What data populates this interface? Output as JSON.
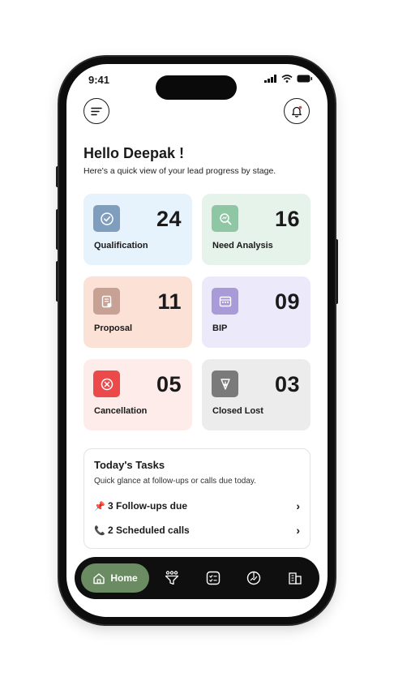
{
  "status_bar": {
    "time": "9:41"
  },
  "header": {
    "menu_icon": "menu-icon",
    "notification_icon": "bell-icon"
  },
  "greeting": {
    "title": "Hello Deepak !",
    "subtitle": "Here's a quick view of your lead progress by stage."
  },
  "stages": [
    {
      "label": "Qualification",
      "count": "24",
      "icon": "check-circle-icon",
      "card_color": "#e6f2fc",
      "icon_color": "#7f9ebd"
    },
    {
      "label": "Need Analysis",
      "count": "16",
      "icon": "search-analysis-icon",
      "card_color": "#e6f3ea",
      "icon_color": "#8fc6a4"
    },
    {
      "label": "Proposal",
      "count": "11",
      "icon": "document-icon",
      "card_color": "#fbe1d6",
      "icon_color": "#c7a294"
    },
    {
      "label": "BIP",
      "count": "09",
      "icon": "calendar-icon",
      "card_color": "#ece9fb",
      "icon_color": "#a99bd8"
    },
    {
      "label": "Cancellation",
      "count": "05",
      "icon": "cancel-icon",
      "card_color": "#fdecea",
      "icon_color": "#ec4a4a"
    },
    {
      "label": "Closed Lost",
      "count": "03",
      "icon": "down-arrow-icon",
      "card_color": "#ececec",
      "icon_color": "#7a7a7a"
    }
  ],
  "tasks": {
    "title": "Today's Tasks",
    "subtitle": "Quick glance at follow-ups or calls due today.",
    "items": [
      {
        "label": "3 Follow-ups due",
        "icon": "pushpin-icon"
      },
      {
        "label": "2 Scheduled calls",
        "icon": "phone-icon"
      }
    ]
  },
  "bottom_nav": {
    "active_label": "Home",
    "items": [
      "home-icon",
      "funnel-icon",
      "tasks-icon",
      "reports-icon",
      "building-icon"
    ],
    "active_color": "#6b8c63"
  }
}
